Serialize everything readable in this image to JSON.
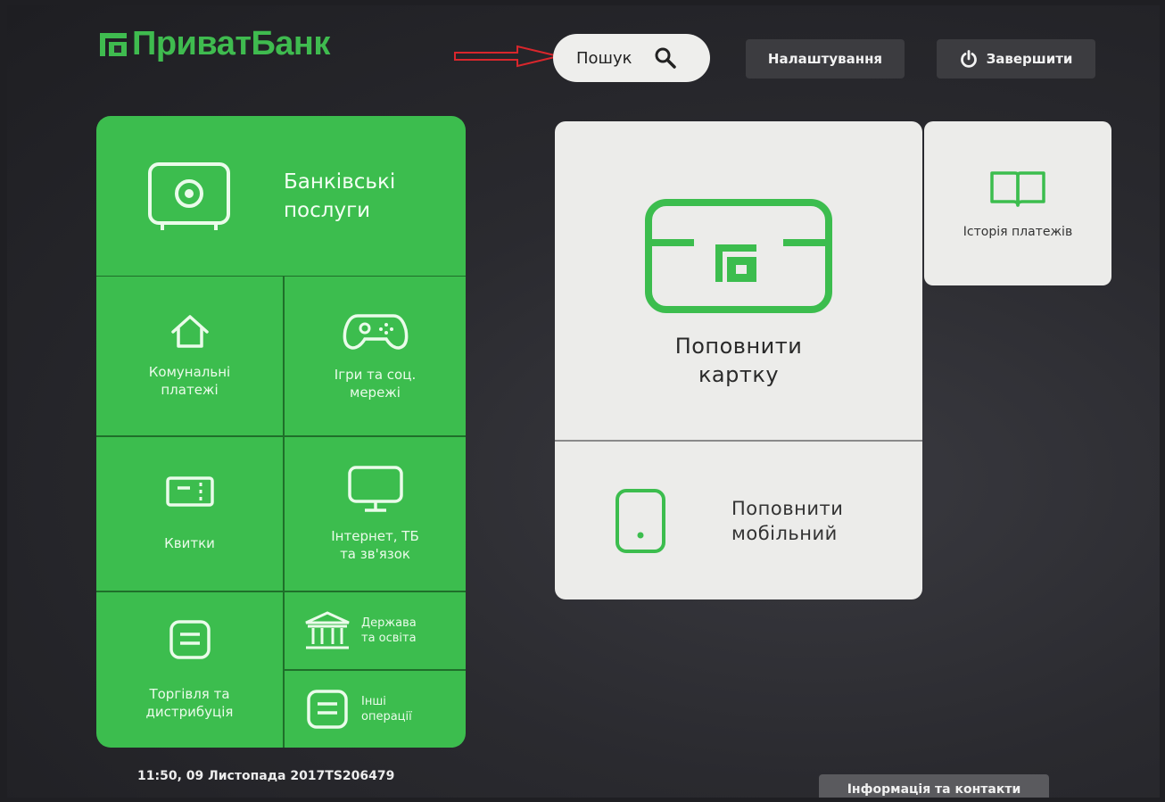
{
  "header": {
    "brand": "ПриватБанк",
    "search_label": "Пошук",
    "settings_label": "Налаштування",
    "exit_label": "Завершити"
  },
  "menu": {
    "banking_services": "Банківські послуги",
    "utilities": "Комунальні платежі",
    "games_social": "Ігри та соц. мережі",
    "tickets": "Квитки",
    "internet_tv": "Інтернет, ТБ та зв'язок",
    "trade": "Торгівля та дистрибуція",
    "state_education": "Держава та освіта",
    "other_operations": "Інші операції"
  },
  "actions": {
    "topup_card": "Поповнити картку",
    "topup_mobile": "Поповнити мобільний",
    "payment_history": "Історія платежів"
  },
  "footer": {
    "timestamp": "11:50,  09 Листопада 2017",
    "terminal_id": "TS206479",
    "info_label": "Інформація та контакти"
  },
  "colors": {
    "brand_green": "#3cbd4e",
    "tile_light": "#ececea",
    "dark_button": "#3c3c40",
    "annotation_arrow": "#d9262c"
  },
  "icons": [
    "safe-icon",
    "house-icon",
    "gamepad-icon",
    "ticket-icon",
    "monitor-icon",
    "register-icon",
    "bank-building-icon",
    "stack-icon",
    "card-icon",
    "phone-icon",
    "book-icon",
    "search-icon",
    "power-icon"
  ]
}
